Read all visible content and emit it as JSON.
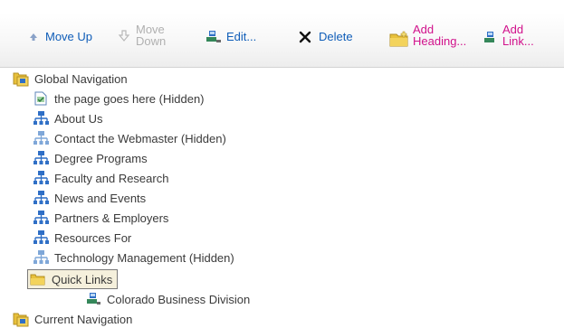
{
  "toolbar": {
    "move_up": "Move Up",
    "move_down": "Move\nDown",
    "edit": "Edit...",
    "delete": "Delete",
    "add_heading": "Add\nHeading...",
    "add_link": "Add\nLink..."
  },
  "tree": {
    "global": "Global Navigation",
    "items": [
      "the page goes here (Hidden)",
      "About Us",
      "Contact the Webmaster (Hidden)",
      "Degree Programs",
      "Faculty and Research",
      "News and Events",
      "Partners & Employers",
      "Resources For",
      "Technology Management (Hidden)"
    ],
    "quick_links": "Quick Links",
    "colorado": "Colorado Business Division",
    "current": "Current Navigation"
  },
  "icons": {
    "folder_color": "#e8c13c",
    "link_color": "#2f6fc6",
    "accent_blue": "#0f5db8",
    "accent_pink": "#d1118b"
  }
}
